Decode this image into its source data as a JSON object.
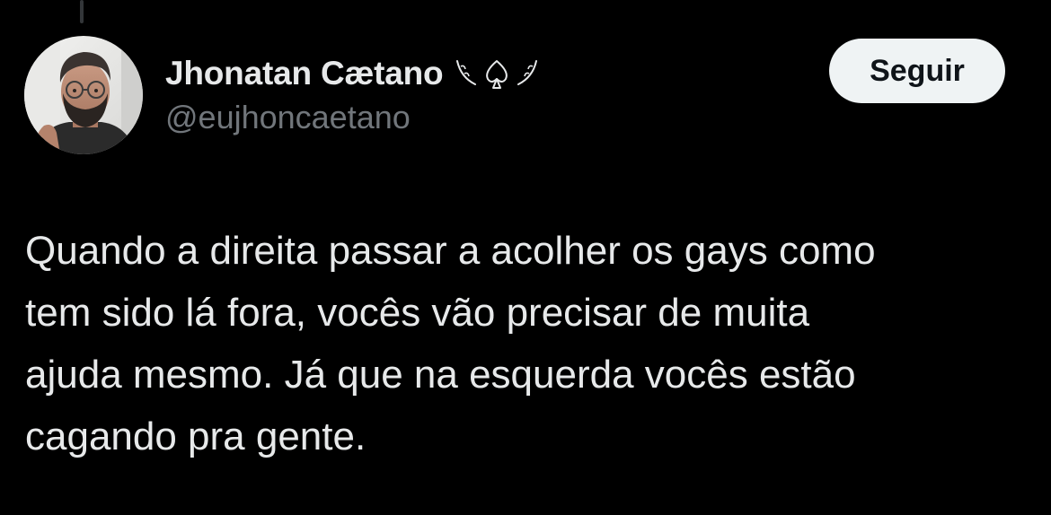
{
  "user": {
    "display_name": "Jhonatan Cætano",
    "handle": "@eujhoncaetano",
    "emblem": "spade-with-laurel-icon",
    "avatar": "profile-photo"
  },
  "actions": {
    "follow_label": "Seguir"
  },
  "tweet": {
    "lines": [
      "Quando a direita passar a acolher os gays como",
      "tem sido lá fora, vocês vão precisar de muita",
      "ajuda mesmo. Já que na esquerda vocês estão",
      "cagando pra gente."
    ]
  },
  "colors": {
    "background": "#000000",
    "text_primary": "#e7e9ea",
    "text_secondary": "#71767b",
    "button_bg": "#eff3f4",
    "button_text": "#0f1419"
  }
}
